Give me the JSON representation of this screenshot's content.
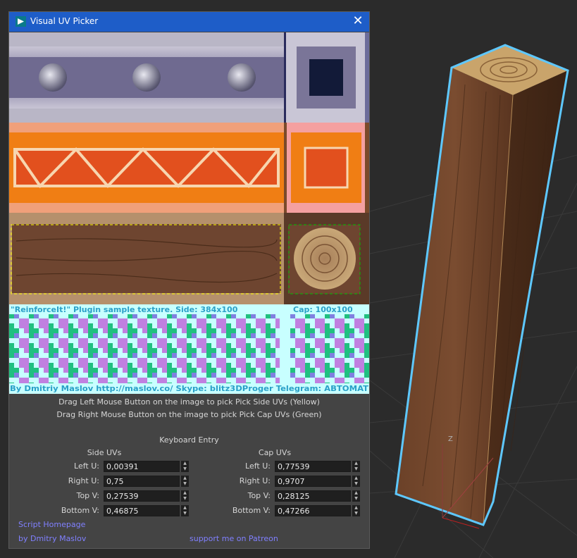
{
  "window": {
    "title": "Visual UV Picker"
  },
  "texture": {
    "caption": "\"ReinforceIt!\" Plugin sample texture. Side: 384x100",
    "cap_caption": "Cap: 100x100",
    "author_line": "By Dmitriy Maslov http://maslov.co/ Skype: blitz3DProger Telegram: ABTOMAT"
  },
  "instructions": {
    "line1": "Drag Left Mouse Button on the image to pick Pick Side UVs (Yellow)",
    "line2": "Drag Right Mouse Button on the image to pick Pick Cap UVs (Green)"
  },
  "keyboard": {
    "title": "Keyboard Entry",
    "side": {
      "header": "Side UVs",
      "fields": [
        {
          "label": "Left U:",
          "value": "0,00391"
        },
        {
          "label": "Right U:",
          "value": "0,75"
        },
        {
          "label": "Top V:",
          "value": "0,27539"
        },
        {
          "label": "Bottom V:",
          "value": "0,46875"
        }
      ]
    },
    "cap": {
      "header": "Cap UVs",
      "fields": [
        {
          "label": "Left U:",
          "value": "0,77539"
        },
        {
          "label": "Right U:",
          "value": "0,9707"
        },
        {
          "label": "Top V:",
          "value": "0,28125"
        },
        {
          "label": "Bottom V:",
          "value": "0,47266"
        }
      ]
    }
  },
  "links": {
    "homepage": "Script Homepage",
    "author": "by Dmitry Maslov",
    "patreon": "support me on Patreon"
  },
  "viewport": {
    "axis_label": "Z"
  },
  "colors": {
    "title_bar": "#1e5dc8",
    "dialog_bg": "#444444",
    "link": "#8080ff",
    "selection_outline": "#5ec8ff",
    "side_selection": "#ffff00",
    "cap_selection": "#00c000"
  }
}
